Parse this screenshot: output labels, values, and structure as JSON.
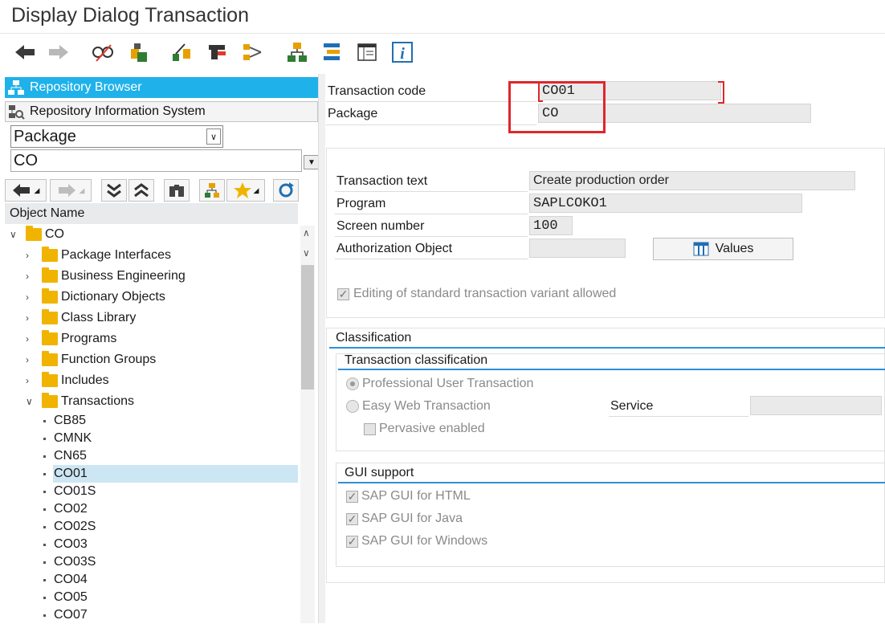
{
  "window": {
    "title": "Display Dialog Transaction"
  },
  "toolbar": {
    "icons": [
      "back-arrow-icon",
      "forward-arrow-icon",
      "display-change-icon",
      "activate-icon",
      "where-used-icon",
      "other-object-icon",
      "navigate-icon",
      "hierarchy-icon",
      "object-list-icon",
      "layout-icon",
      "info-icon"
    ],
    "info_glyph": "i"
  },
  "left": {
    "repo_browser": "Repository Browser",
    "repo_info": "Repository Information System",
    "select_value": "Package",
    "input_value": "CO",
    "header": "Object Name",
    "root": "CO",
    "folders": [
      "Package Interfaces",
      "Business Engineering",
      "Dictionary Objects",
      "Class Library",
      "Programs",
      "Function Groups",
      "Includes"
    ],
    "open_folder": "Transactions",
    "transactions": [
      "CB85",
      "CMNK",
      "CN65",
      "CO01",
      "CO01S",
      "CO02",
      "CO02S",
      "CO03",
      "CO03S",
      "CO04",
      "CO05",
      "CO07"
    ],
    "selected": "CO01"
  },
  "header_fields": {
    "tcode_label": "Transaction code",
    "tcode_value": "CO01",
    "package_label": "Package",
    "package_value": "CO"
  },
  "details": {
    "text_label": "Transaction text",
    "text_value": "Create production order",
    "program_label": "Program",
    "program_value": "SAPLCOKO1",
    "screen_label": "Screen number",
    "screen_value": "100",
    "auth_label": "Authorization Object",
    "auth_value": "",
    "values_button": "Values",
    "editing_checkbox": "Editing of standard transaction variant allowed"
  },
  "classification": {
    "title": "Classification",
    "sub_title": "Transaction classification",
    "radio1": "Professional User Transaction",
    "radio2": "Easy Web Transaction",
    "pervasive": "Pervasive enabled",
    "service_label": "Service",
    "service_value": ""
  },
  "gui": {
    "title": "GUI support",
    "html": "SAP GUI for HTML",
    "java": "SAP GUI for Java",
    "windows": "SAP GUI for Windows"
  }
}
